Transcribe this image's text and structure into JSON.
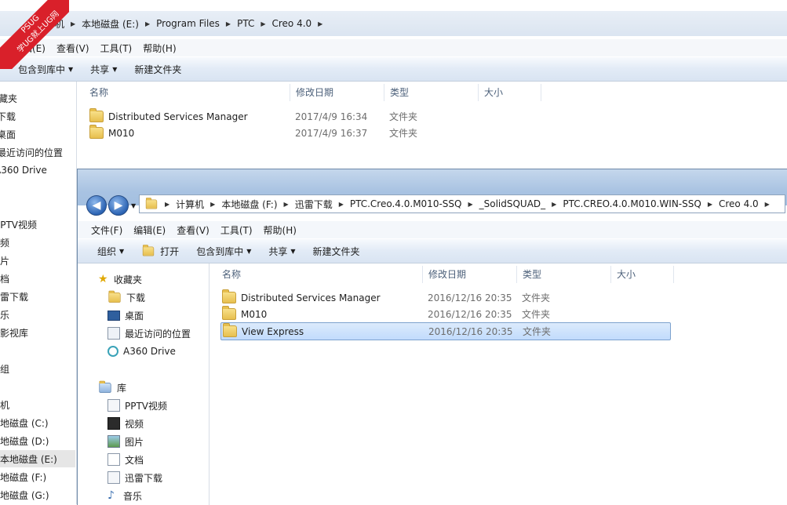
{
  "back_window": {
    "breadcrumb": [
      "计算机",
      "本地磁盘 (E:)",
      "Program Files",
      "PTC",
      "Creo 4.0"
    ],
    "menu": [
      "编辑(E)",
      "查看(V)",
      "工具(T)",
      "帮助(H)"
    ],
    "toolbar": {
      "include": "包含到库中",
      "share": "共享",
      "new_folder": "新建文件夹"
    },
    "columns": {
      "name": "名称",
      "modified": "修改日期",
      "type": "类型",
      "size": "大小"
    },
    "files": [
      {
        "name": "Distributed Services Manager",
        "modified": "2017/4/9 16:34",
        "type": "文件夹"
      },
      {
        "name": "M010",
        "modified": "2017/4/9 16:37",
        "type": "文件夹"
      }
    ],
    "nav": [
      "藏夹",
      "下载",
      "桌面",
      "最近访问的位置",
      "A360 Drive",
      "PPTV视频",
      "视频",
      "图片",
      "文档",
      "迅雷下载",
      "音乐",
      "酷影视库",
      "家庭组",
      "计算机",
      "本地磁盘 (C:)",
      "本地磁盘 (D:)",
      "本地磁盘 (E:)",
      "本地磁盘 (F:)",
      "本地磁盘 (G:)"
    ]
  },
  "front_window": {
    "breadcrumb": [
      "计算机",
      "本地磁盘 (F:)",
      "迅雷下载",
      "PTC.Creo.4.0.M010-SSQ",
      "_SolidSQUAD_",
      "PTC.CREO.4.0.M010.WIN-SSQ",
      "Creo 4.0"
    ],
    "menu": [
      "文件(F)",
      "编辑(E)",
      "查看(V)",
      "工具(T)",
      "帮助(H)"
    ],
    "toolbar": {
      "organize": "组织",
      "open": "打开",
      "include": "包含到库中",
      "share": "共享",
      "new_folder": "新建文件夹"
    },
    "columns": {
      "name": "名称",
      "modified": "修改日期",
      "type": "类型",
      "size": "大小"
    },
    "files": [
      {
        "name": "Distributed Services Manager",
        "modified": "2016/12/16 20:35",
        "type": "文件夹"
      },
      {
        "name": "M010",
        "modified": "2016/12/16 20:35",
        "type": "文件夹"
      },
      {
        "name": "View Express",
        "modified": "2016/12/16 20:35",
        "type": "文件夹"
      }
    ],
    "nav": {
      "favorites": "收藏夹",
      "favorites_items": [
        "下载",
        "桌面",
        "最近访问的位置",
        "A360 Drive"
      ],
      "library": "库",
      "library_items": [
        "PPTV视频",
        "视频",
        "图片",
        "文档",
        "迅雷下载",
        "音乐"
      ]
    }
  },
  "watermark": {
    "line1": "PSUG",
    "line2": "学UG就上UG网"
  }
}
